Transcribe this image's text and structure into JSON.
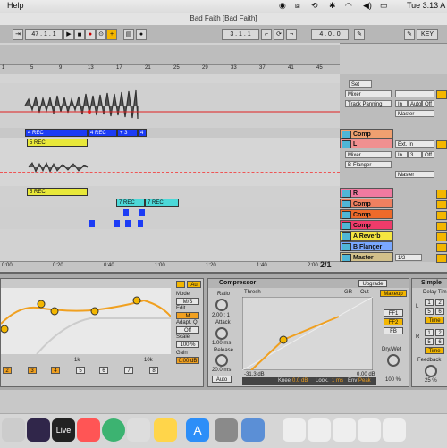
{
  "menubar": {
    "help": "Help",
    "clock": "Tue 3:13 A"
  },
  "window": {
    "title": "Bad Faith  [Bad Faith]"
  },
  "transport": {
    "bar_pos": "47 . 1 . 1",
    "loop_start": "3 . 1 . 1",
    "loop_length": "4 . 0 . 0",
    "key_label": "KEY"
  },
  "ruler": {
    "bars": [
      "1",
      "5",
      "9",
      "13",
      "17",
      "21",
      "25",
      "29",
      "33",
      "37",
      "41",
      "45"
    ]
  },
  "time_ruler": {
    "times": [
      "0:00",
      "0:20",
      "0:40",
      "1:00",
      "1:20",
      "1:40",
      "2:00"
    ],
    "page": "2/1"
  },
  "clips": {
    "rec_4a": "4 REC",
    "rec_4b": "4 REC",
    "rec_plus3": "+ 3",
    "rec_4c": "4",
    "rec_5a": "5 REC",
    "rec_5b": "5 REC",
    "rec_7a": "7 REC",
    "rec_7b": "7 REC"
  },
  "mixer": {
    "set_label": "Set",
    "top_device": "Mixer",
    "top_param": "Track Panning",
    "in_label": "In",
    "auto_label": "Auto",
    "off_label": "Off",
    "master_sel": "Master",
    "ext_in": "Ext. In",
    "in_3": "3",
    "mixer_sel": "Mixer",
    "flanger_sel": "B-Flanger",
    "tracks": [
      {
        "name": "Comp",
        "color": "#f0a070"
      },
      {
        "name": "L",
        "color": "#f09090"
      },
      {
        "name": "R",
        "color": "#f07aa0"
      },
      {
        "name": "Comp",
        "color": "#f08060"
      },
      {
        "name": "Comp",
        "color": "#ee6a2a"
      },
      {
        "name": "Comp",
        "color": "#ef3b6a"
      },
      {
        "name": "A Reverb",
        "color": "#f5e640"
      },
      {
        "name": "B Flanger",
        "color": "#7aa8ff"
      },
      {
        "name": "Master",
        "color": "#d2c08a"
      }
    ],
    "master_ratio": "1/2"
  },
  "eq": {
    "mode_label": "Mode",
    "mode_value": "M/S",
    "edit_label": "Edit",
    "edit_value": "M",
    "adapt_label": "Adapt. Q",
    "adapt_value": "Off",
    "scale_label": "Scale",
    "scale_value": "100 %",
    "gain_label": "Gain",
    "gain_value": "0.00 dB",
    "band_nums": [
      "2",
      "3",
      "4",
      "5",
      "6",
      "7",
      "8"
    ],
    "freq_1k": "1k",
    "freq_10k": "10k",
    "top_toggle": "Au"
  },
  "compressor": {
    "title": "Compressor",
    "upgrade": "Upgrade",
    "ratio_label": "Ratio",
    "ratio_value": "2.00 : 1",
    "attack_label": "Attack",
    "attack_value": "1.00 ms",
    "release_label": "Release",
    "release_value": "20.0 ms",
    "auto": "Auto",
    "thresh_label": "Thresh",
    "gr_label": "GR",
    "out_label": "Out",
    "thresh_value": "-31.3 dB",
    "out_value": "0.00 dB",
    "knee_label": "Knee",
    "knee_value": "0.0 dB",
    "look_label": "Look.",
    "look_value": "1 ms",
    "env_label": "Env",
    "env_value": "Peak",
    "makeup": "Makeup",
    "ff1": "FF1",
    "ff2": "FF2",
    "fb": "FB",
    "drywet_label": "Dry/Wet",
    "drywet_value": "100 %"
  },
  "simple_delay": {
    "title": "Simple",
    "delay_label": "Delay Tim",
    "l": "L",
    "r": "R",
    "sync_vals": [
      "1",
      "2",
      "5",
      "6",
      "1",
      "2",
      "5",
      "6"
    ],
    "time_label": "Time",
    "feedback_label": "Feedback",
    "feedback_value": "25 %"
  },
  "dock": {
    "live_label": "Live"
  },
  "colors": {
    "rec_blue": "#1c3cf5",
    "clip_yellow": "#e8e83a",
    "clip_teal": "#4cd8d8",
    "accent": "#f0a020"
  }
}
